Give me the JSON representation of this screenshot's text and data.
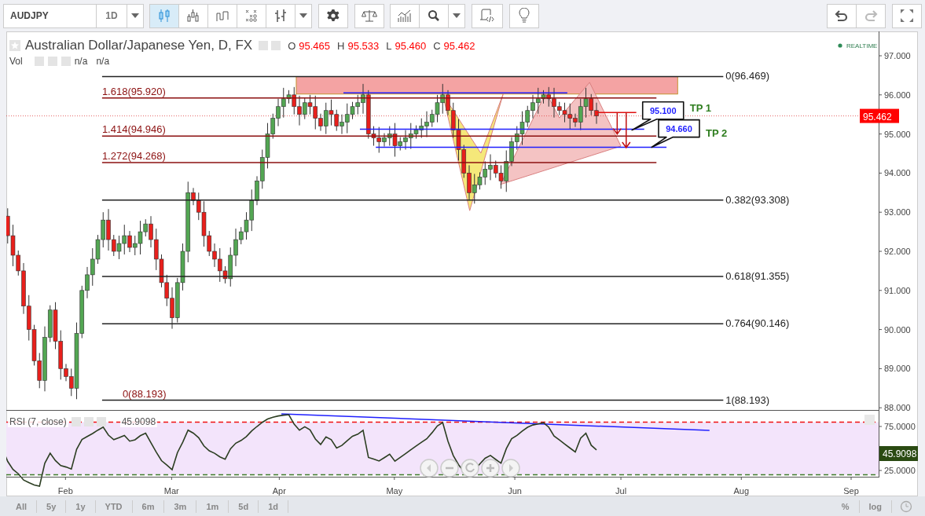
{
  "toolbar": {
    "symbol": "AUDJPY",
    "interval": "1D",
    "chart_styles": [
      {
        "kind": "candles",
        "selected": true
      },
      {
        "kind": "hollow",
        "selected": false
      },
      {
        "kind": "line",
        "selected": false
      },
      {
        "kind": "pnf",
        "selected": false
      },
      {
        "kind": "bars",
        "selected": false
      }
    ],
    "undo": {
      "disabled": false
    },
    "redo": {
      "disabled": true
    }
  },
  "legend": {
    "title": "Australian Dollar/Japanese Yen, D, FX",
    "ohlc": [
      {
        "label": "O",
        "value": "95.465"
      },
      {
        "label": "H",
        "value": "95.533"
      },
      {
        "label": "L",
        "value": "95.460"
      },
      {
        "label": "C",
        "value": "95.462"
      }
    ],
    "volume": {
      "label": "Vol",
      "values": [
        "n/a",
        "n/a"
      ]
    }
  },
  "realtime": "REALTIME",
  "price_axis": [
    "97.000",
    "96.000",
    "95.000",
    "94.000",
    "93.000",
    "92.000",
    "91.000",
    "90.000",
    "89.000",
    "88.000"
  ],
  "last_price": "95.462",
  "fib_retracement": {
    "right_labels": [
      "0(96.469)",
      "0.382(93.308)",
      "0.618(91.355)",
      "0.764(90.146)",
      "1(88.193)"
    ],
    "left_label": "0(88.193)"
  },
  "fib_extension": {
    "labels": [
      "1.618(95.920)",
      "1.414(94.946)",
      "1.272(94.268)"
    ]
  },
  "callouts": [
    "95.100",
    "94.660"
  ],
  "targets": [
    "TP 1",
    "TP 2"
  ],
  "rsi": {
    "legend": "RSI (7, close)",
    "value": "45.9098",
    "axis": [
      "75.0000",
      "25.0000"
    ],
    "tag": "45.9098"
  },
  "time_axis": [
    "Feb",
    "Mar",
    "Apr",
    "May",
    "Jun",
    "Jul",
    "Aug",
    "Sep"
  ],
  "range_buttons": [
    "All",
    "5y",
    "1y",
    "YTD",
    "6m",
    "3m",
    "1m",
    "5d",
    "1d"
  ],
  "scale_buttons": [
    "%",
    "log"
  ]
}
